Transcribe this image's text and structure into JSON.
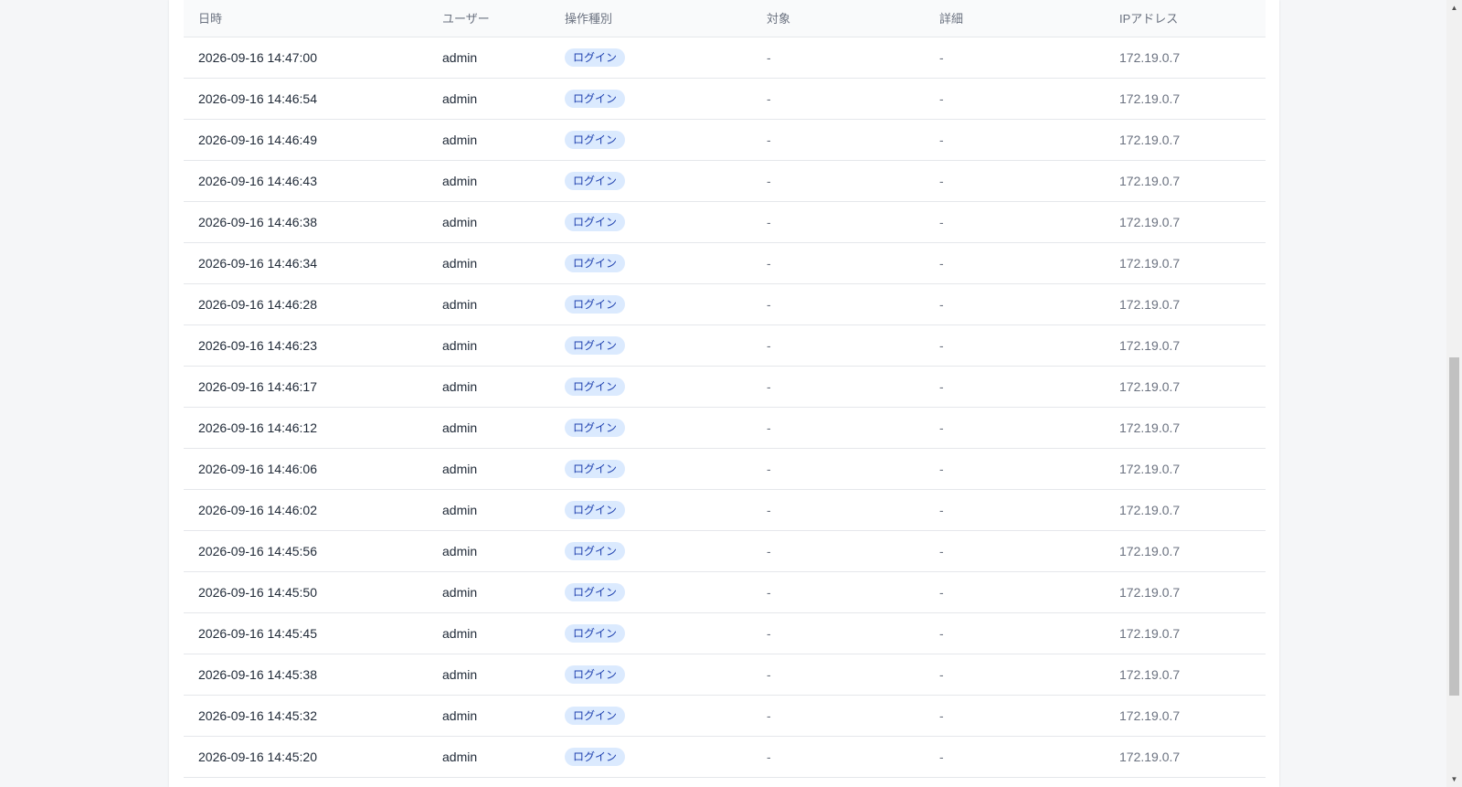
{
  "table": {
    "headers": {
      "datetime": "日時",
      "user": "ユーザー",
      "op_type": "操作種別",
      "target": "対象",
      "detail": "詳細",
      "ip": "IPアドレス"
    },
    "rows": [
      {
        "datetime": "2026-09-16 14:47:00",
        "user": "admin",
        "op": "ログイン",
        "target": "-",
        "detail": "-",
        "ip": "172.19.0.7"
      },
      {
        "datetime": "2026-09-16 14:46:54",
        "user": "admin",
        "op": "ログイン",
        "target": "-",
        "detail": "-",
        "ip": "172.19.0.7"
      },
      {
        "datetime": "2026-09-16 14:46:49",
        "user": "admin",
        "op": "ログイン",
        "target": "-",
        "detail": "-",
        "ip": "172.19.0.7"
      },
      {
        "datetime": "2026-09-16 14:46:43",
        "user": "admin",
        "op": "ログイン",
        "target": "-",
        "detail": "-",
        "ip": "172.19.0.7"
      },
      {
        "datetime": "2026-09-16 14:46:38",
        "user": "admin",
        "op": "ログイン",
        "target": "-",
        "detail": "-",
        "ip": "172.19.0.7"
      },
      {
        "datetime": "2026-09-16 14:46:34",
        "user": "admin",
        "op": "ログイン",
        "target": "-",
        "detail": "-",
        "ip": "172.19.0.7"
      },
      {
        "datetime": "2026-09-16 14:46:28",
        "user": "admin",
        "op": "ログイン",
        "target": "-",
        "detail": "-",
        "ip": "172.19.0.7"
      },
      {
        "datetime": "2026-09-16 14:46:23",
        "user": "admin",
        "op": "ログイン",
        "target": "-",
        "detail": "-",
        "ip": "172.19.0.7"
      },
      {
        "datetime": "2026-09-16 14:46:17",
        "user": "admin",
        "op": "ログイン",
        "target": "-",
        "detail": "-",
        "ip": "172.19.0.7"
      },
      {
        "datetime": "2026-09-16 14:46:12",
        "user": "admin",
        "op": "ログイン",
        "target": "-",
        "detail": "-",
        "ip": "172.19.0.7"
      },
      {
        "datetime": "2026-09-16 14:46:06",
        "user": "admin",
        "op": "ログイン",
        "target": "-",
        "detail": "-",
        "ip": "172.19.0.7"
      },
      {
        "datetime": "2026-09-16 14:46:02",
        "user": "admin",
        "op": "ログイン",
        "target": "-",
        "detail": "-",
        "ip": "172.19.0.7"
      },
      {
        "datetime": "2026-09-16 14:45:56",
        "user": "admin",
        "op": "ログイン",
        "target": "-",
        "detail": "-",
        "ip": "172.19.0.7"
      },
      {
        "datetime": "2026-09-16 14:45:50",
        "user": "admin",
        "op": "ログイン",
        "target": "-",
        "detail": "-",
        "ip": "172.19.0.7"
      },
      {
        "datetime": "2026-09-16 14:45:45",
        "user": "admin",
        "op": "ログイン",
        "target": "-",
        "detail": "-",
        "ip": "172.19.0.7"
      },
      {
        "datetime": "2026-09-16 14:45:38",
        "user": "admin",
        "op": "ログイン",
        "target": "-",
        "detail": "-",
        "ip": "172.19.0.7"
      },
      {
        "datetime": "2026-09-16 14:45:32",
        "user": "admin",
        "op": "ログイン",
        "target": "-",
        "detail": "-",
        "ip": "172.19.0.7"
      },
      {
        "datetime": "2026-09-16 14:45:20",
        "user": "admin",
        "op": "ログイン",
        "target": "-",
        "detail": "-",
        "ip": "172.19.0.7"
      }
    ]
  },
  "scrollbar": {
    "up_icon": "triangle-up",
    "down_icon": "triangle-down"
  },
  "colors": {
    "badge_background": "#dbeafe",
    "badge_text": "#1e40af",
    "page_background": "#f5f6f8"
  }
}
